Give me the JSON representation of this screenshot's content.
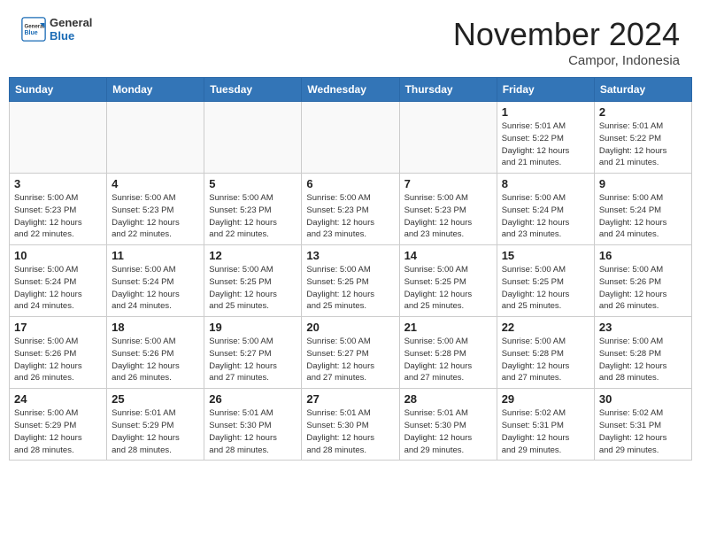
{
  "header": {
    "logo_general": "General",
    "logo_blue": "Blue",
    "month_title": "November 2024",
    "location": "Campor, Indonesia"
  },
  "weekdays": [
    "Sunday",
    "Monday",
    "Tuesday",
    "Wednesday",
    "Thursday",
    "Friday",
    "Saturday"
  ],
  "weeks": [
    [
      {
        "date": "",
        "info": ""
      },
      {
        "date": "",
        "info": ""
      },
      {
        "date": "",
        "info": ""
      },
      {
        "date": "",
        "info": ""
      },
      {
        "date": "",
        "info": ""
      },
      {
        "date": "1",
        "info": "Sunrise: 5:01 AM\nSunset: 5:22 PM\nDaylight: 12 hours\nand 21 minutes."
      },
      {
        "date": "2",
        "info": "Sunrise: 5:01 AM\nSunset: 5:22 PM\nDaylight: 12 hours\nand 21 minutes."
      }
    ],
    [
      {
        "date": "3",
        "info": "Sunrise: 5:00 AM\nSunset: 5:23 PM\nDaylight: 12 hours\nand 22 minutes."
      },
      {
        "date": "4",
        "info": "Sunrise: 5:00 AM\nSunset: 5:23 PM\nDaylight: 12 hours\nand 22 minutes."
      },
      {
        "date": "5",
        "info": "Sunrise: 5:00 AM\nSunset: 5:23 PM\nDaylight: 12 hours\nand 22 minutes."
      },
      {
        "date": "6",
        "info": "Sunrise: 5:00 AM\nSunset: 5:23 PM\nDaylight: 12 hours\nand 23 minutes."
      },
      {
        "date": "7",
        "info": "Sunrise: 5:00 AM\nSunset: 5:23 PM\nDaylight: 12 hours\nand 23 minutes."
      },
      {
        "date": "8",
        "info": "Sunrise: 5:00 AM\nSunset: 5:24 PM\nDaylight: 12 hours\nand 23 minutes."
      },
      {
        "date": "9",
        "info": "Sunrise: 5:00 AM\nSunset: 5:24 PM\nDaylight: 12 hours\nand 24 minutes."
      }
    ],
    [
      {
        "date": "10",
        "info": "Sunrise: 5:00 AM\nSunset: 5:24 PM\nDaylight: 12 hours\nand 24 minutes."
      },
      {
        "date": "11",
        "info": "Sunrise: 5:00 AM\nSunset: 5:24 PM\nDaylight: 12 hours\nand 24 minutes."
      },
      {
        "date": "12",
        "info": "Sunrise: 5:00 AM\nSunset: 5:25 PM\nDaylight: 12 hours\nand 25 minutes."
      },
      {
        "date": "13",
        "info": "Sunrise: 5:00 AM\nSunset: 5:25 PM\nDaylight: 12 hours\nand 25 minutes."
      },
      {
        "date": "14",
        "info": "Sunrise: 5:00 AM\nSunset: 5:25 PM\nDaylight: 12 hours\nand 25 minutes."
      },
      {
        "date": "15",
        "info": "Sunrise: 5:00 AM\nSunset: 5:25 PM\nDaylight: 12 hours\nand 25 minutes."
      },
      {
        "date": "16",
        "info": "Sunrise: 5:00 AM\nSunset: 5:26 PM\nDaylight: 12 hours\nand 26 minutes."
      }
    ],
    [
      {
        "date": "17",
        "info": "Sunrise: 5:00 AM\nSunset: 5:26 PM\nDaylight: 12 hours\nand 26 minutes."
      },
      {
        "date": "18",
        "info": "Sunrise: 5:00 AM\nSunset: 5:26 PM\nDaylight: 12 hours\nand 26 minutes."
      },
      {
        "date": "19",
        "info": "Sunrise: 5:00 AM\nSunset: 5:27 PM\nDaylight: 12 hours\nand 27 minutes."
      },
      {
        "date": "20",
        "info": "Sunrise: 5:00 AM\nSunset: 5:27 PM\nDaylight: 12 hours\nand 27 minutes."
      },
      {
        "date": "21",
        "info": "Sunrise: 5:00 AM\nSunset: 5:28 PM\nDaylight: 12 hours\nand 27 minutes."
      },
      {
        "date": "22",
        "info": "Sunrise: 5:00 AM\nSunset: 5:28 PM\nDaylight: 12 hours\nand 27 minutes."
      },
      {
        "date": "23",
        "info": "Sunrise: 5:00 AM\nSunset: 5:28 PM\nDaylight: 12 hours\nand 28 minutes."
      }
    ],
    [
      {
        "date": "24",
        "info": "Sunrise: 5:00 AM\nSunset: 5:29 PM\nDaylight: 12 hours\nand 28 minutes."
      },
      {
        "date": "25",
        "info": "Sunrise: 5:01 AM\nSunset: 5:29 PM\nDaylight: 12 hours\nand 28 minutes."
      },
      {
        "date": "26",
        "info": "Sunrise: 5:01 AM\nSunset: 5:30 PM\nDaylight: 12 hours\nand 28 minutes."
      },
      {
        "date": "27",
        "info": "Sunrise: 5:01 AM\nSunset: 5:30 PM\nDaylight: 12 hours\nand 28 minutes."
      },
      {
        "date": "28",
        "info": "Sunrise: 5:01 AM\nSunset: 5:30 PM\nDaylight: 12 hours\nand 29 minutes."
      },
      {
        "date": "29",
        "info": "Sunrise: 5:02 AM\nSunset: 5:31 PM\nDaylight: 12 hours\nand 29 minutes."
      },
      {
        "date": "30",
        "info": "Sunrise: 5:02 AM\nSunset: 5:31 PM\nDaylight: 12 hours\nand 29 minutes."
      }
    ]
  ]
}
